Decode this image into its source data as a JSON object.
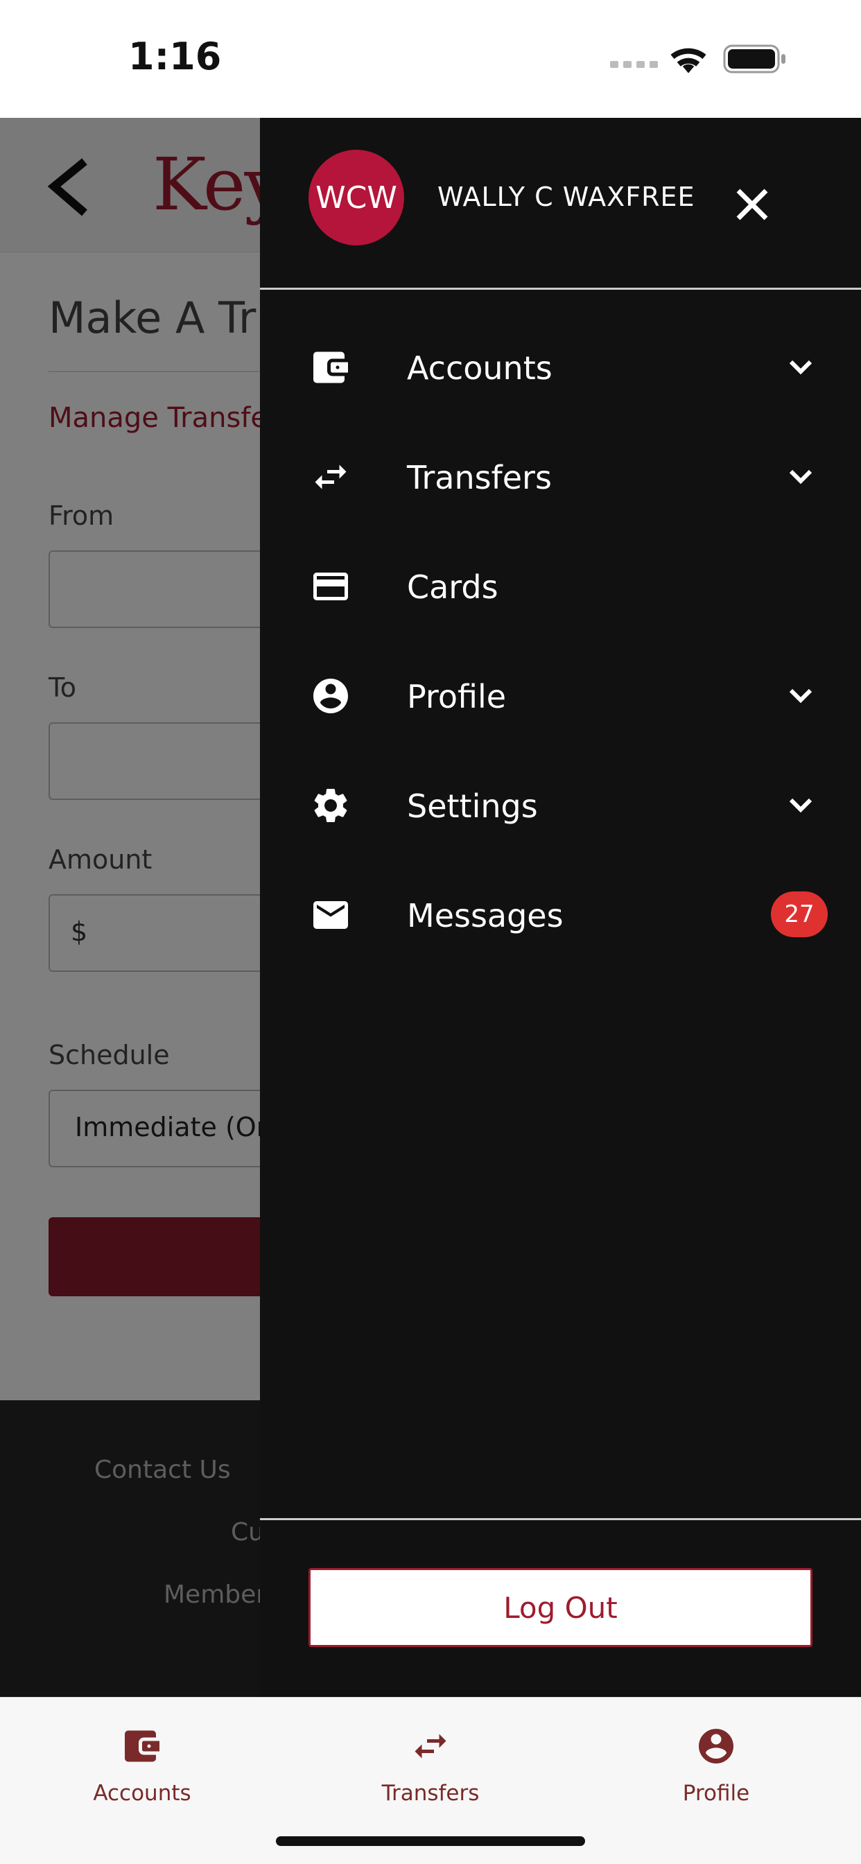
{
  "status_bar": {
    "time": "1:16"
  },
  "page": {
    "logo_text": "Key",
    "title": "Make A Tr",
    "manage_link": "Manage Transfe",
    "from_label": "From",
    "to_label": "To",
    "amount_label": "Amount",
    "amount_prefix": "$",
    "schedule_label": "Schedule",
    "schedule_value": "Immediate (Or",
    "footer_links": [
      "Contact Us",
      "Cu",
      "Member"
    ]
  },
  "drawer": {
    "avatar_initials": "WCW",
    "user_name": "WALLY C WAXFREE",
    "menu": [
      {
        "label": "Accounts",
        "icon": "wallet-icon",
        "has_chevron": true
      },
      {
        "label": "Transfers",
        "icon": "transfer-arrows-icon",
        "has_chevron": true
      },
      {
        "label": "Cards",
        "icon": "credit-card-icon",
        "has_chevron": false
      },
      {
        "label": "Profile",
        "icon": "account-circle-icon",
        "has_chevron": true
      },
      {
        "label": "Settings",
        "icon": "gear-icon",
        "has_chevron": true
      },
      {
        "label": "Messages",
        "icon": "envelope-icon",
        "badge": "27"
      }
    ],
    "logout_label": "Log Out"
  },
  "tab_bar": {
    "tabs": [
      {
        "label": "Accounts",
        "icon": "wallet-icon"
      },
      {
        "label": "Transfers",
        "icon": "transfer-arrows-icon"
      },
      {
        "label": "Profile",
        "icon": "account-circle-icon"
      }
    ]
  },
  "colors": {
    "brand": "#9e1b2e",
    "drawer_bg": "#111111",
    "badge": "#e03131",
    "avatar": "#b5153a",
    "tab_icon": "#7a2a2a"
  }
}
